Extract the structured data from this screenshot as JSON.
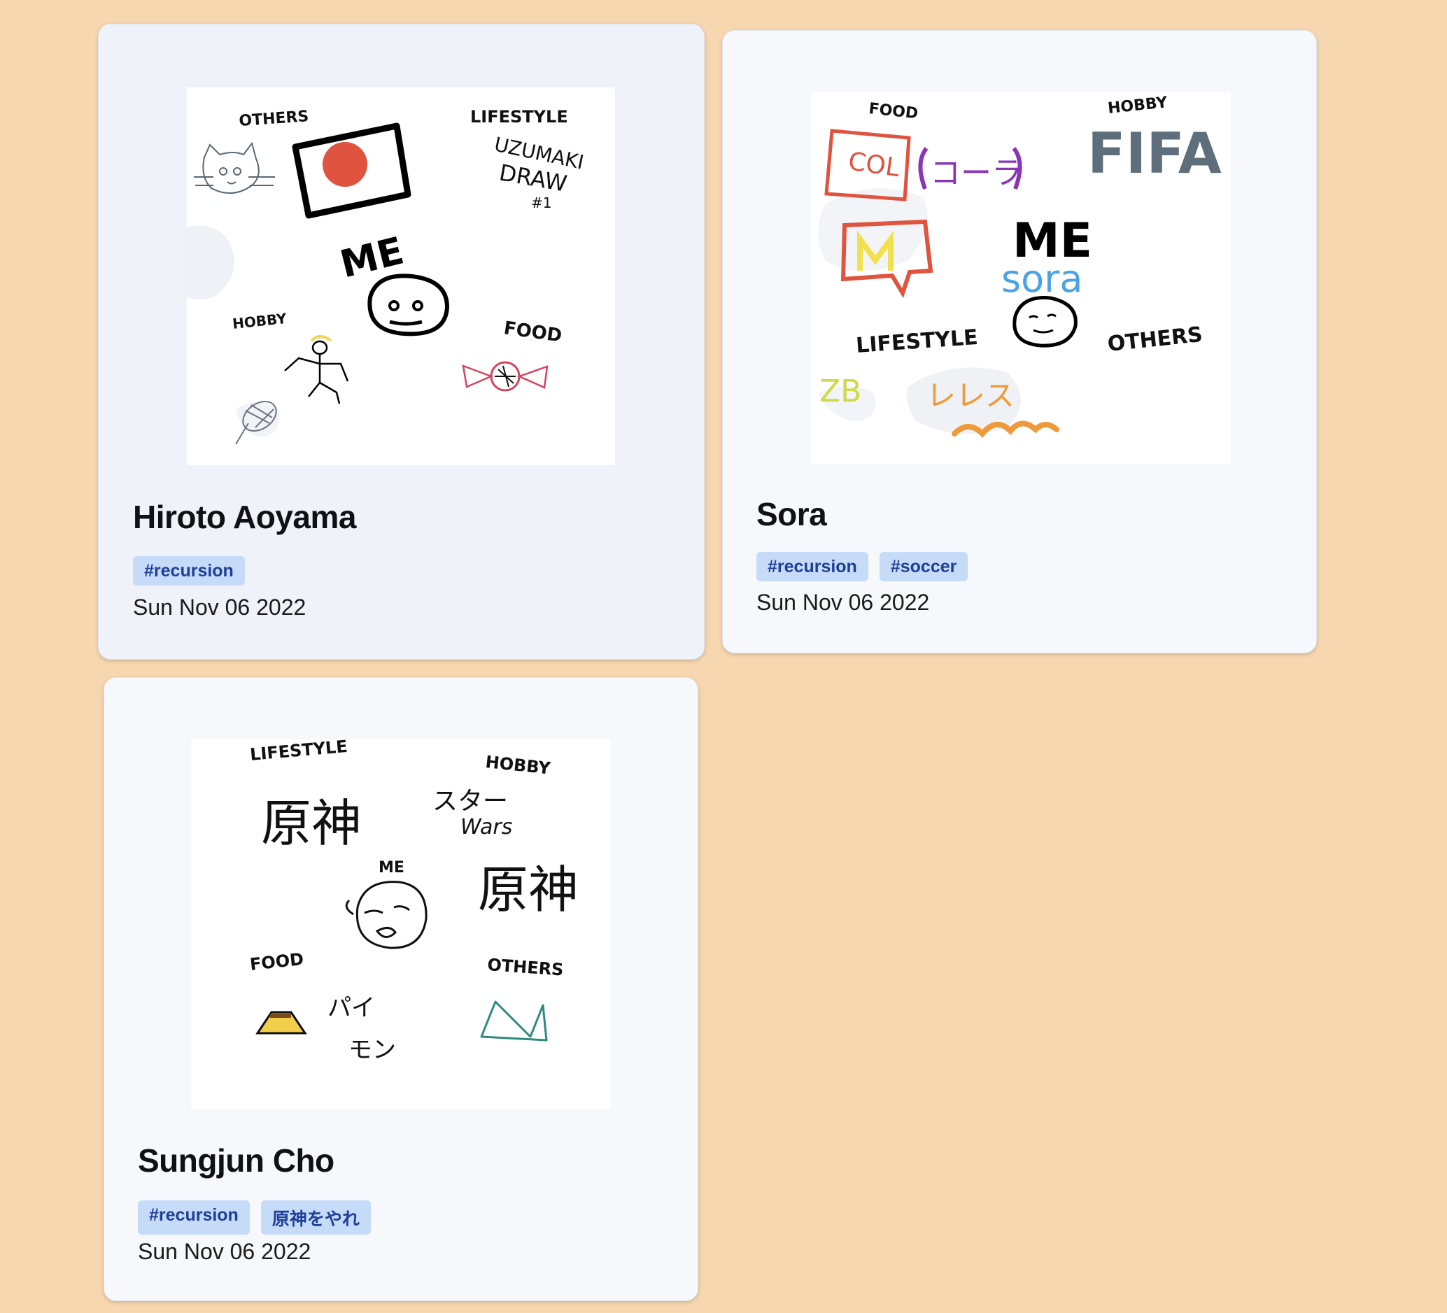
{
  "cards": [
    {
      "name": "Hiroto Aoyama",
      "tags": [
        "#recursion"
      ],
      "date": "Sun Nov 06 2022",
      "drawing_labels": {
        "others": "OTHERS",
        "lifestyle": "LIFESTYLE",
        "lifestyle_note_1": "UZUMAKI",
        "lifestyle_note_2": "DRAW",
        "lifestyle_note_3": "#1",
        "me": "ME",
        "hobby": "HOBBY",
        "food": "FOOD"
      }
    },
    {
      "name": "Sora",
      "tags": [
        "#recursion",
        "#soccer"
      ],
      "date": "Sun Nov 06 2022",
      "drawing_labels": {
        "food": "FOOD",
        "food_note_1": "COL",
        "food_note_2": "コーラ",
        "hobby": "HOBBY",
        "hobby_note": "FIFA",
        "me": "ME",
        "me_note": "sora",
        "lifestyle": "LIFESTYLE",
        "lifestyle_note_1": "ZB",
        "lifestyle_note_2": "レレス",
        "others": "OTHERS"
      }
    },
    {
      "name": "Sungjun Cho",
      "tags": [
        "#recursion",
        "原神をやれ"
      ],
      "date": "Sun Nov 06 2022",
      "drawing_labels": {
        "lifestyle": "LIFESTYLE",
        "lifestyle_note": "原神",
        "hobby": "HOBBY",
        "hobby_note_1": "スター",
        "hobby_note_2": "Wars",
        "hobby_note_3": "原神",
        "me": "ME",
        "food": "FOOD",
        "food_note_1": "パイ",
        "food_note_2": "モン",
        "others": "OTHERS"
      }
    }
  ]
}
